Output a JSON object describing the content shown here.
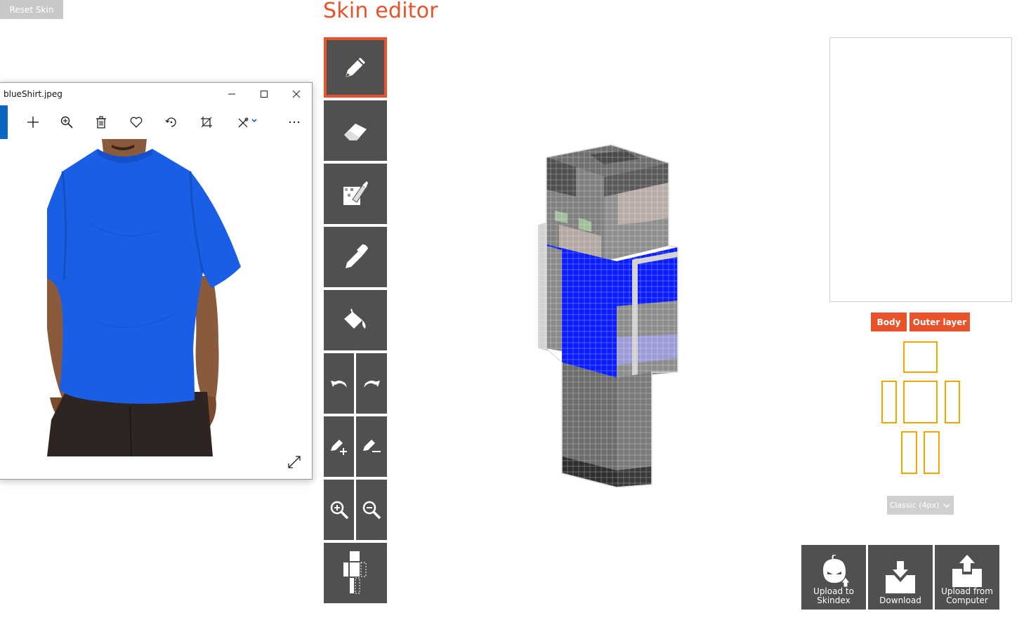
{
  "page": {
    "title": "Skin editor"
  },
  "toolbar": {
    "tools": [
      {
        "name": "pencil-tool",
        "icon": "pencil-icon",
        "active": true
      },
      {
        "name": "eraser-tool",
        "icon": "eraser-icon"
      },
      {
        "name": "noise-brush-tool",
        "icon": "noise-brush-icon"
      },
      {
        "name": "color-picker-tool",
        "icon": "eyedropper-icon"
      },
      {
        "name": "fill-bucket-tool",
        "icon": "paint-bucket-icon"
      }
    ],
    "reset_label": "Reset Skin"
  },
  "viewer": {
    "title": "blueShirt.jpeg",
    "toolbar_icons": [
      "add-icon",
      "zoom-icon",
      "delete-icon",
      "favorite-icon",
      "rotate-icon",
      "crop-icon",
      "edit-icon",
      "more-icon"
    ]
  },
  "right_panel": {
    "layer_buttons": {
      "body": "Body",
      "outer": "Outer layer"
    },
    "model_select": "Classic (4px)",
    "actions": {
      "upload_skindex": "Upload to\nSkindex",
      "download": "Download",
      "upload_computer": "Upload from\nComputer"
    }
  },
  "colors": {
    "accent": "#e8532c",
    "tool_bg": "#505050",
    "part_outline": "#f0a500",
    "shirt_blue": "#0a1dff",
    "viewer_accent": "#0b66c3"
  }
}
